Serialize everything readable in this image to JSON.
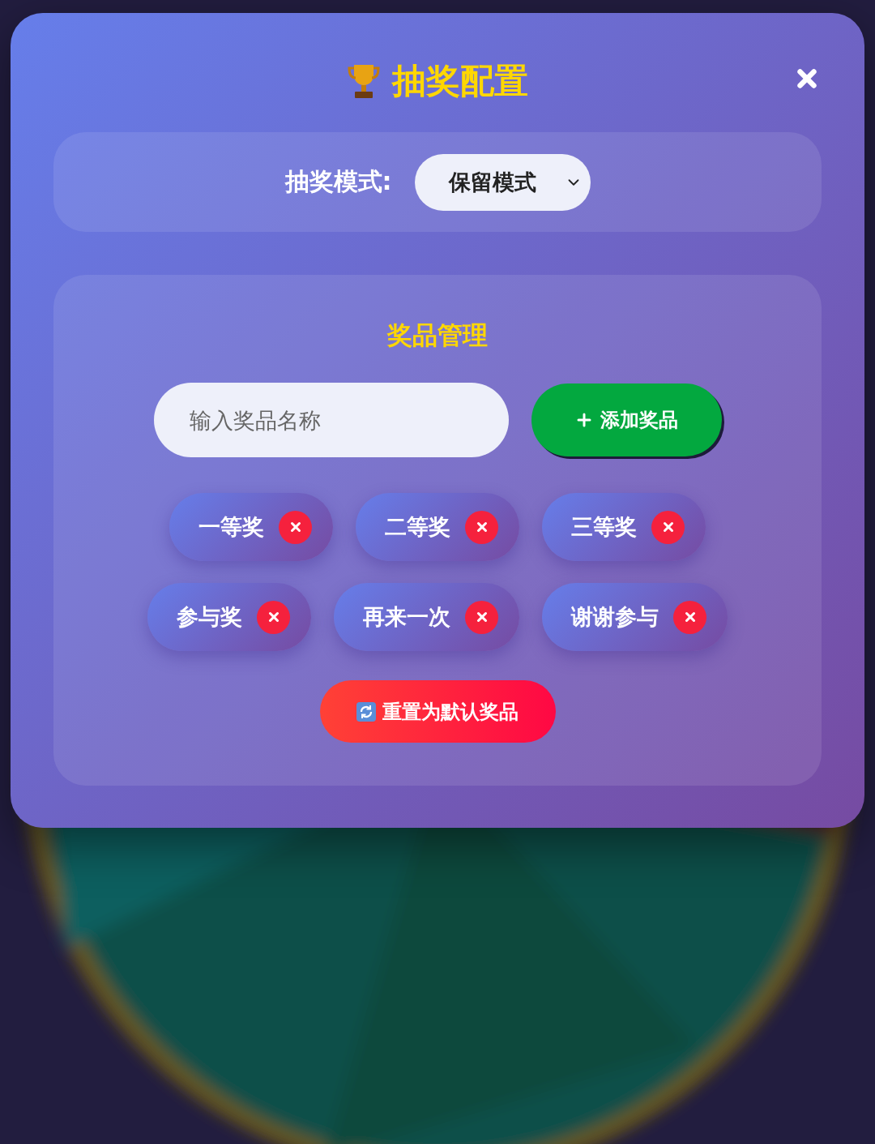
{
  "dialog": {
    "title": "抽奖配置"
  },
  "mode": {
    "label": "抽奖模式:",
    "value": "保留模式"
  },
  "prizes": {
    "title": "奖品管理",
    "input": {
      "placeholder": "输入奖品名称"
    },
    "add_button": "添加奖品",
    "items": [
      {
        "name": "一等奖"
      },
      {
        "name": "二等奖"
      },
      {
        "name": "三等奖"
      },
      {
        "name": "参与奖"
      },
      {
        "name": "再来一次"
      },
      {
        "name": "谢谢参与"
      }
    ],
    "reset_button": "重置为默认奖品"
  }
}
